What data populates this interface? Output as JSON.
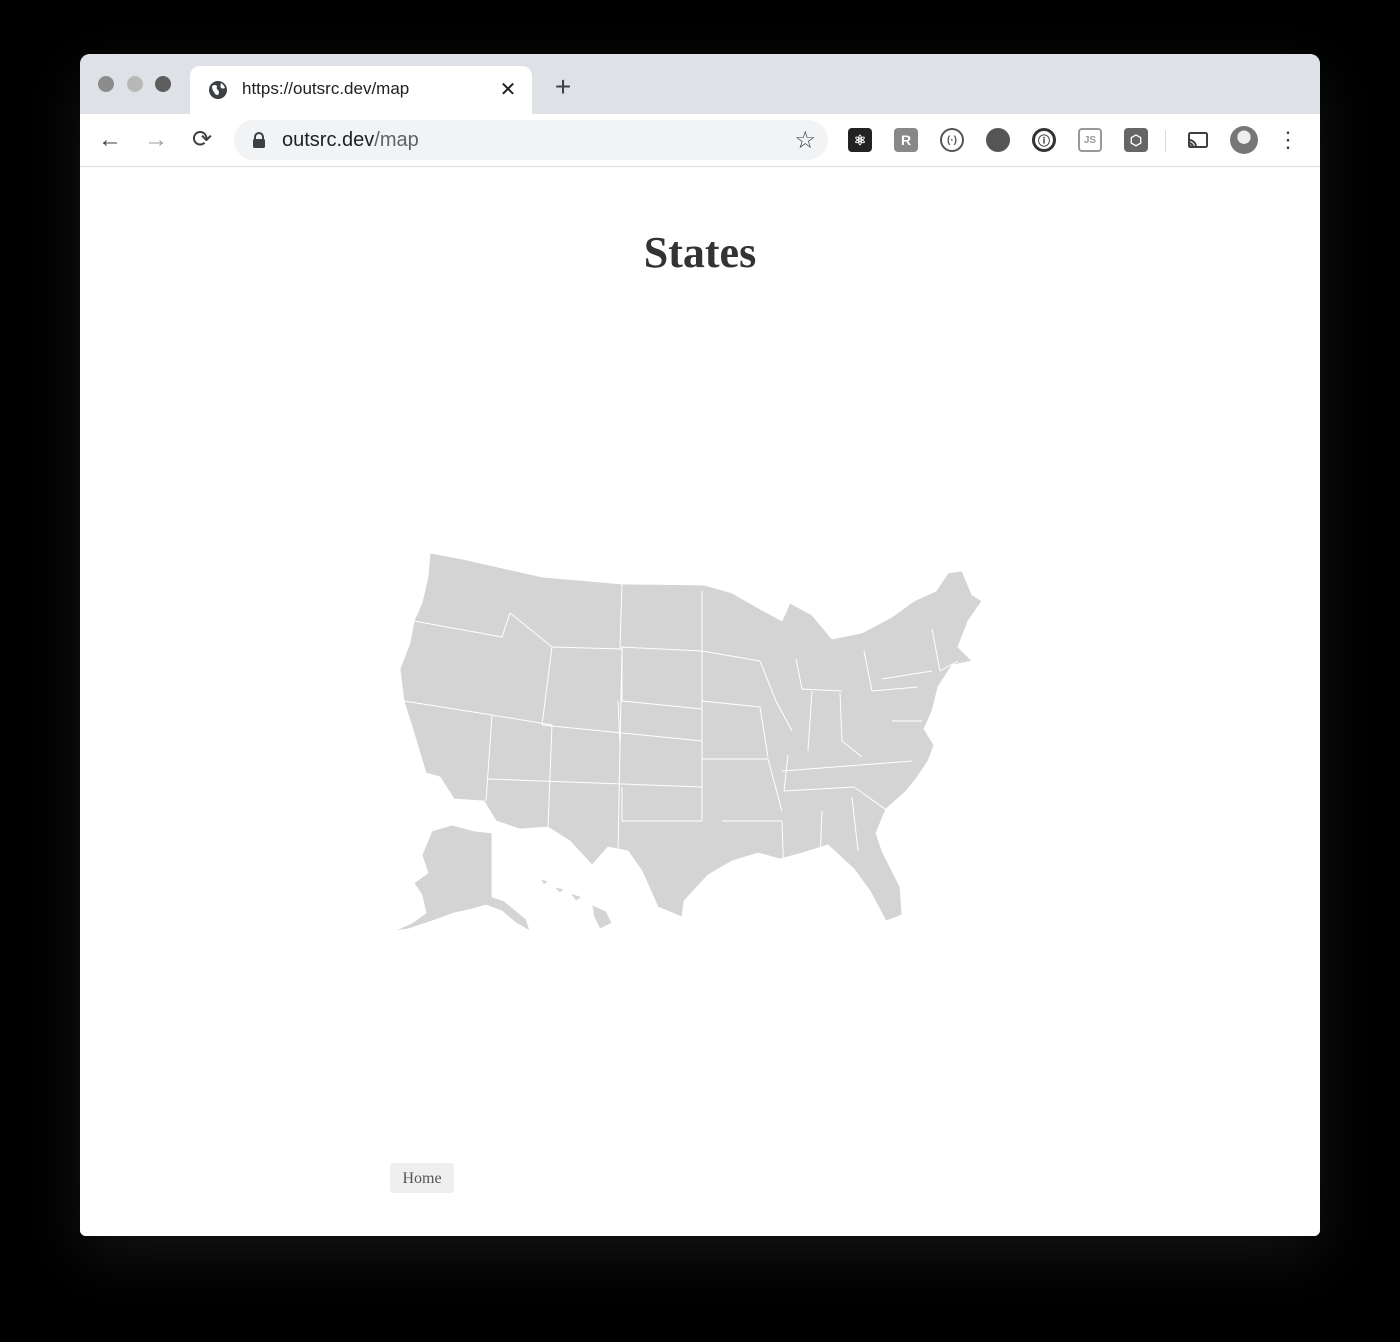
{
  "browser": {
    "tab_title": "https://outsrc.dev/map",
    "tab_close": "✕",
    "new_tab": "+",
    "url_host": "outsrc.dev",
    "url_path": "/map",
    "nav_back": "←",
    "nav_forward": "→",
    "nav_reload": "⟳",
    "bookmark_star": "☆",
    "menu": "⋮",
    "extensions": [
      "react-devtools-icon",
      "r-extension-icon",
      "code-extension-icon",
      "ghost-extension-icon",
      "onepassword-icon",
      "nodejs-icon",
      "box-extension-icon"
    ],
    "extension_glyphs": [
      "⚛",
      "R",
      "(·)",
      "",
      "ⓘ",
      "JS",
      "⬡"
    ]
  },
  "page": {
    "title": "States",
    "home_button": "Home"
  },
  "map": {
    "fill_color": "#d4d4d4",
    "border_color": "#ffffff"
  }
}
